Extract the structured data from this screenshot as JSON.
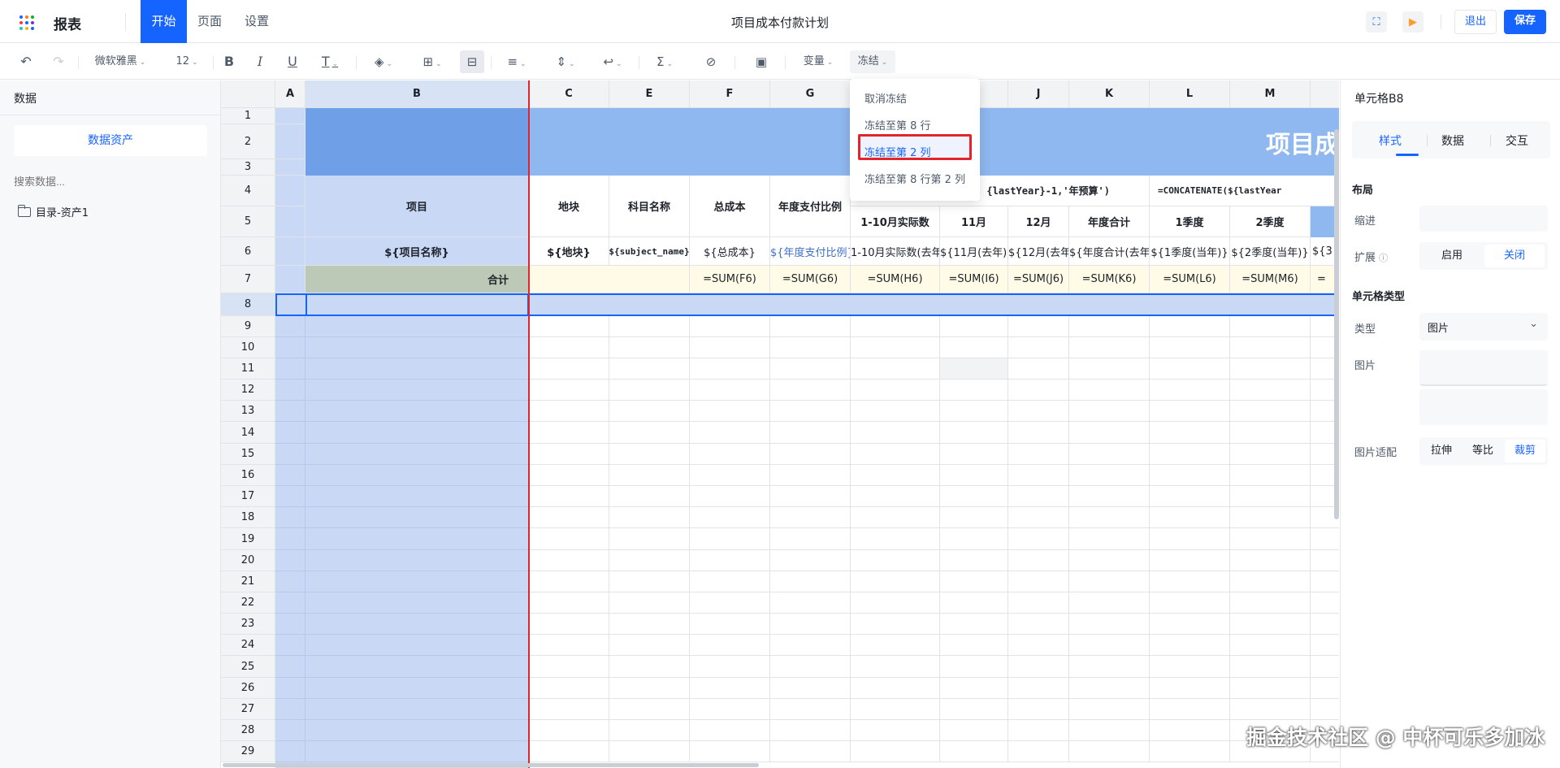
{
  "header": {
    "brand": "报表",
    "menus": [
      "开始",
      "页面",
      "设置"
    ],
    "title": "项目成本付款计划",
    "exit_label": "退出",
    "save_label": "保存"
  },
  "toolbar": {
    "font": "微软雅黑",
    "font_size": "12",
    "variable_label": "变量",
    "freeze_label": "冻结"
  },
  "left_panel": {
    "title": "数据",
    "assets_button": "数据资产",
    "search_placeholder": "搜索数据...",
    "tree_item": "目录-资产1"
  },
  "freeze_menu": {
    "items": [
      "取消冻结",
      "冻结至第 8 行",
      "冻结至第 2 列",
      "冻结至第 8 行第 2 列"
    ],
    "highlighted": "冻结至第 2 列"
  },
  "sheet": {
    "columns": [
      "A",
      "B",
      "C",
      "E",
      "F",
      "G",
      "",
      "",
      "J",
      "K",
      "L",
      "M",
      ""
    ],
    "rows": [
      "1",
      "2",
      "3",
      "4",
      "5",
      "6",
      "7",
      "8",
      "9",
      "10",
      "11",
      "12",
      "13",
      "14",
      "15",
      "16",
      "17",
      "18",
      "19",
      "20",
      "21",
      "22",
      "23",
      "24",
      "25",
      "26",
      "27",
      "28",
      "29"
    ],
    "banner_title": "项目成",
    "header_row4": {
      "B": "项目",
      "C": "地块",
      "E": "科目名称",
      "F": "总成本",
      "G": "年度支付比例",
      "HIJK": "{lastYear}-1,'年预算')",
      "LM": "=CONCATENATE(${lastYear"
    },
    "header_row5": {
      "H": "1-10月实际数",
      "I": "11月",
      "J": "12月",
      "K": "年度合计",
      "L": "1季度",
      "M": "2季度"
    },
    "row6": {
      "B": "${项目名称}",
      "C": "${地块}",
      "E": "${subject_name}",
      "F": "${总成本}",
      "G": "${年度支付比例}",
      "H": "1-10月实际数(去年",
      "I": "${11月(去年)}",
      "J": "${12月(去年)}",
      "K": "${年度合计(去年)}",
      "L": "${1季度(当年)}",
      "M": "${2季度(当年)}",
      "N": "${3"
    },
    "row7": {
      "B": "合计",
      "F": "=SUM(F6)",
      "G": "=SUM(G6)",
      "H": "=SUM(H6)",
      "I": "=SUM(I6)",
      "J": "=SUM(J6)",
      "K": "=SUM(K6)",
      "L": "=SUM(L6)",
      "M": "=SUM(M6)",
      "N": "="
    }
  },
  "right_panel": {
    "title": "单元格B8",
    "tabs": [
      "样式",
      "数据",
      "交互"
    ],
    "layout_section": "布局",
    "indent_label": "缩进",
    "expand_label": "扩展",
    "expand_options": [
      "启用",
      "关闭"
    ],
    "cell_type_section": "单元格类型",
    "type_label": "类型",
    "type_value": "图片",
    "image_label": "图片",
    "fit_label": "图片适配",
    "fit_options": [
      "拉伸",
      "等比",
      "裁剪"
    ]
  },
  "watermark": "掘金技术社区 @ 中杯可乐多加冰",
  "colors": {
    "accent": "#1664ff",
    "frozen_line": "#e3242b",
    "selection": "#c9d8f5",
    "banner": "#8fb7f0"
  }
}
